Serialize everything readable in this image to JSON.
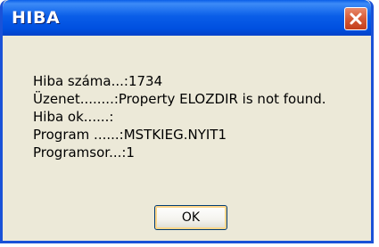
{
  "window": {
    "title": "HIBA"
  },
  "message": {
    "lines": [
      "Hiba száma...:1734",
      "Üzenet........:Property ELOZDIR is not found.",
      "Hiba ok......:",
      "Program ......:MSTKIEG.NYIT1",
      "Programsor...:1"
    ]
  },
  "buttons": {
    "ok_label": "OK"
  },
  "icons": {
    "close": "close-icon"
  },
  "colors": {
    "titlebar": "#0a5ee8",
    "close_button": "#d65a36",
    "dialog_body": "#ece9d8"
  }
}
